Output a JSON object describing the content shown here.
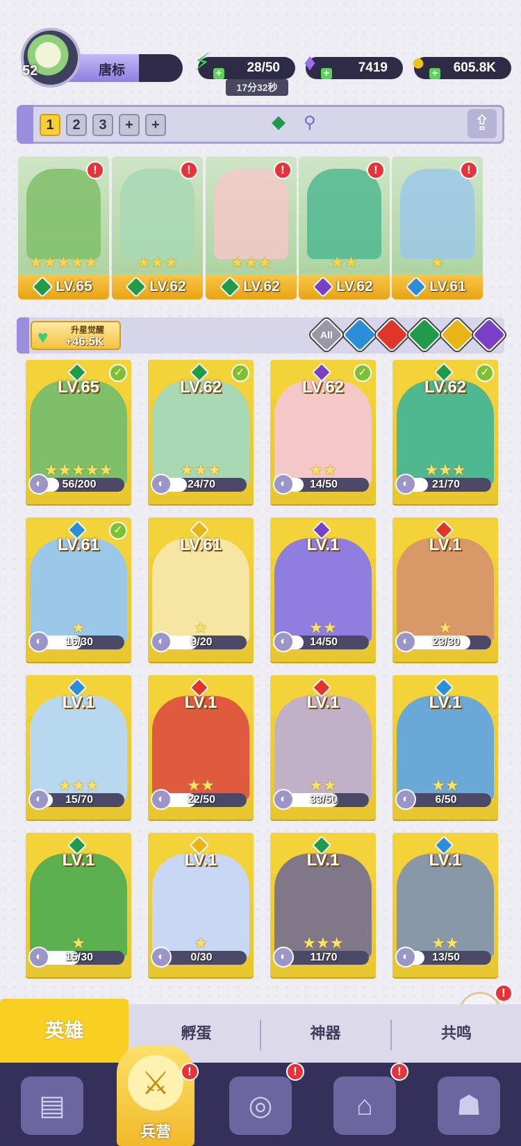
{
  "player": {
    "level": "52",
    "name": "唐标"
  },
  "resources": {
    "stamina": {
      "value": "28/50",
      "icon": "lightning-icon"
    },
    "stamina_timer": "17分32秒",
    "gems": {
      "value": "7419",
      "icon": "diamond-icon"
    },
    "gold": {
      "value": "605.8K",
      "icon": "coin-icon"
    }
  },
  "team_tabs": [
    "1",
    "2",
    "3",
    "+",
    "+"
  ],
  "team": [
    {
      "level": "LV.65",
      "stars": "★★★★★",
      "element": "nature",
      "alert": "!"
    },
    {
      "level": "LV.62",
      "stars": "★★★",
      "element": "nature",
      "alert": "!"
    },
    {
      "level": "LV.62",
      "stars": "★★★",
      "element": "nature",
      "alert": "!"
    },
    {
      "level": "LV.62",
      "stars": "★★",
      "element": "dark",
      "alert": "!"
    },
    {
      "level": "LV.61",
      "stars": "★",
      "element": "water",
      "alert": "!"
    }
  ],
  "awaken": {
    "title": "升星觉醒",
    "value": "+46.5K"
  },
  "filters": [
    "All",
    "water",
    "fire",
    "nature",
    "light",
    "dark"
  ],
  "heroes": [
    {
      "level": "LV.65",
      "progress": "56/200",
      "pct": 0.28,
      "stars": "★★★★★",
      "element": "nature",
      "ready": true
    },
    {
      "level": "LV.62",
      "progress": "24/70",
      "pct": 0.34,
      "stars": "★★★",
      "element": "nature",
      "ready": true
    },
    {
      "level": "LV.62",
      "progress": "14/50",
      "pct": 0.28,
      "stars": "★★",
      "element": "dark",
      "ready": true
    },
    {
      "level": "LV.62",
      "progress": "21/70",
      "pct": 0.3,
      "stars": "★★★",
      "element": "nature",
      "ready": true
    },
    {
      "level": "LV.61",
      "progress": "16/30",
      "pct": 0.53,
      "stars": "★",
      "element": "water",
      "ready": true
    },
    {
      "level": "LV.61",
      "progress": "9/20",
      "pct": 0.45,
      "stars": "★",
      "element": "light",
      "ready": false
    },
    {
      "level": "LV.1",
      "progress": "14/50",
      "pct": 0.28,
      "stars": "★★",
      "element": "dark",
      "ready": false
    },
    {
      "level": "LV.1",
      "progress": "23/30",
      "pct": 0.77,
      "stars": "★",
      "element": "fire",
      "ready": false
    },
    {
      "level": "LV.1",
      "progress": "15/70",
      "pct": 0.21,
      "stars": "★★★",
      "element": "water",
      "ready": false
    },
    {
      "level": "LV.1",
      "progress": "22/50",
      "pct": 0.44,
      "stars": "★★",
      "element": "fire",
      "ready": false
    },
    {
      "level": "LV.1",
      "progress": "33/50",
      "pct": 0.66,
      "stars": "★★",
      "element": "fire",
      "ready": false
    },
    {
      "level": "LV.1",
      "progress": "6/50",
      "pct": 0.12,
      "stars": "★★",
      "element": "water",
      "ready": false
    },
    {
      "level": "LV.1",
      "progress": "15/30",
      "pct": 0.5,
      "stars": "★",
      "element": "nature",
      "ready": false
    },
    {
      "level": "LV.1",
      "progress": "0/30",
      "pct": 0.0,
      "stars": "★",
      "element": "light",
      "ready": false
    },
    {
      "level": "LV.1",
      "progress": "11/70",
      "pct": 0.16,
      "stars": "★★★",
      "element": "nature",
      "ready": false
    },
    {
      "level": "LV.1",
      "progress": "13/50",
      "pct": 0.26,
      "stars": "★★",
      "element": "water",
      "ready": false
    }
  ],
  "sub_tabs": [
    "英雄",
    "孵蛋",
    "神器",
    "共鸣"
  ],
  "nav": {
    "barracks": "兵营",
    "alert": "!"
  },
  "colors": {
    "nature": "#1f9b4a",
    "water": "#2a8fd8",
    "fire": "#e0362a",
    "light": "#e8b418",
    "dark": "#7b40c8",
    "accent": "#f9cf22"
  }
}
